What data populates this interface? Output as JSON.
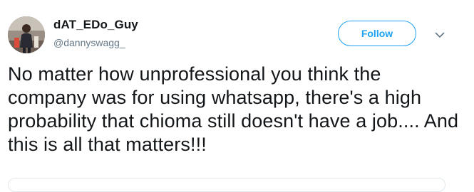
{
  "tweet": {
    "author": {
      "display_name": "dAT_EDo_Guy",
      "handle": "@dannyswagg_",
      "avatar_icon": "user-avatar-photo"
    },
    "follow_label": "Follow",
    "menu_icon": "chevron-down-icon",
    "text": "No matter how unprofessional you think the company was for using whatsapp, there's a high probability that chioma still doesn't have a job.... And this is all that matters!!!"
  },
  "colors": {
    "accent": "#1da1f2",
    "text": "#14171a",
    "secondary_text": "#657786",
    "border": "#e1e8ed"
  }
}
